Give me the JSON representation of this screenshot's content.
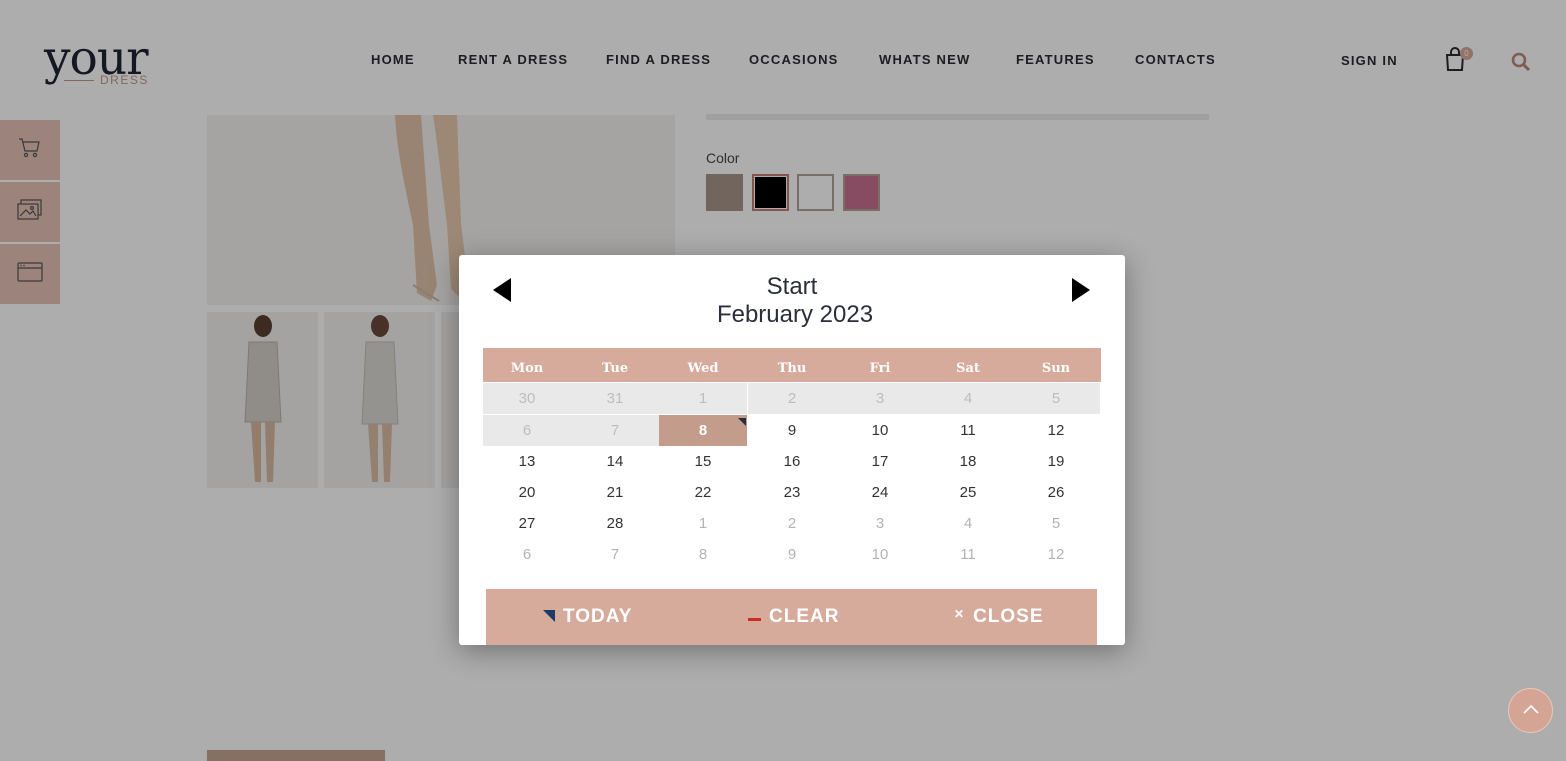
{
  "header": {
    "logo_main": "your",
    "logo_sub": "DRESS",
    "nav": [
      "HOME",
      "RENT A DRESS",
      "FIND A DRESS",
      "OCCASIONS",
      "WHATS NEW",
      "FEATURES",
      "CONTACTS"
    ],
    "sign_in": "SIGN IN",
    "cart_count": "0"
  },
  "sidebar": {
    "items": [
      "cart-icon",
      "gallery-icon",
      "browser-window-icon"
    ]
  },
  "product": {
    "color_label": "Color",
    "swatches": [
      "#a8968a",
      "#000000",
      "#ffffff",
      "#c8708f"
    ],
    "selected_swatch": 1
  },
  "datepicker": {
    "title": "Start",
    "month": "February 2023",
    "weekdays": [
      "Mon",
      "Tue",
      "Wed",
      "Thu",
      "Fri",
      "Sat",
      "Sun"
    ],
    "weeks": [
      [
        "30",
        "31",
        "1",
        "2",
        "3",
        "4",
        "5"
      ],
      [
        "6",
        "7",
        "8",
        "9",
        "10",
        "11",
        "12"
      ],
      [
        "13",
        "14",
        "15",
        "16",
        "17",
        "18",
        "19"
      ],
      [
        "20",
        "21",
        "22",
        "23",
        "24",
        "25",
        "26"
      ],
      [
        "27",
        "28",
        "1",
        "2",
        "3",
        "4",
        "5"
      ],
      [
        "6",
        "7",
        "8",
        "9",
        "10",
        "11",
        "12"
      ]
    ],
    "selected_day": "8",
    "buttons": {
      "today": "TODAY",
      "clear": "CLEAR",
      "close": "CLOSE"
    }
  },
  "colors": {
    "accent": "#d7ab9c",
    "selected": "#c49c8c",
    "text_dark": "#2b2f3a"
  }
}
